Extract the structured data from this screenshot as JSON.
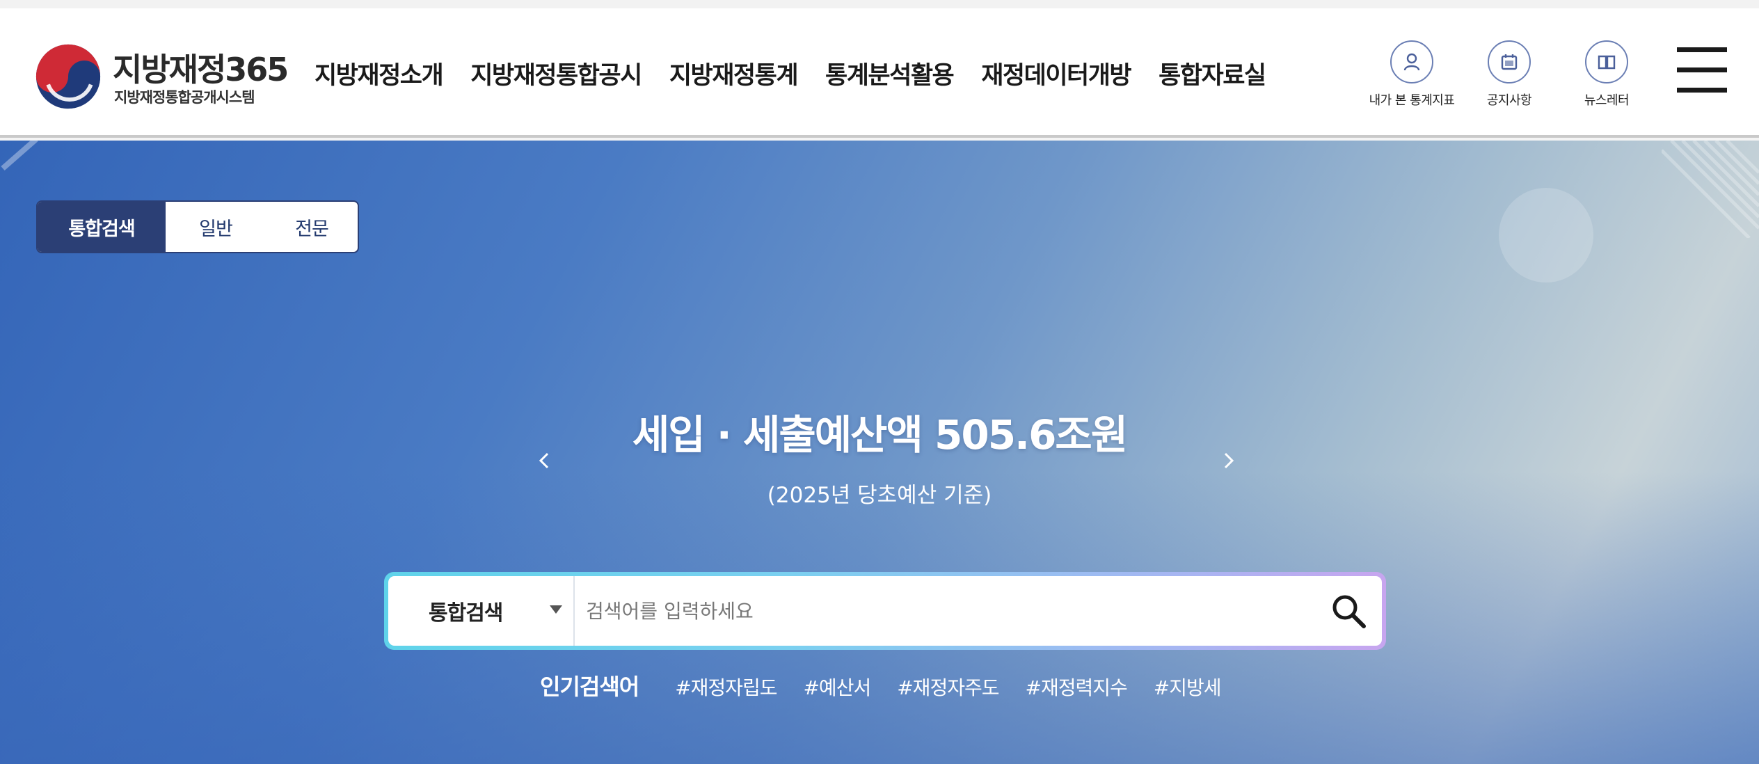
{
  "logo": {
    "title": "지방재정365",
    "subtitle": "지방재정통합공개시스템"
  },
  "nav": {
    "items": [
      "지방재정소개",
      "지방재정통합공시",
      "지방재정통계",
      "통계분석활용",
      "재정데이터개방",
      "통합자료실"
    ]
  },
  "utility": [
    {
      "label": "내가 본 통계지표",
      "icon": "user-icon"
    },
    {
      "label": "공지사항",
      "icon": "calendar-icon"
    },
    {
      "label": "뉴스레터",
      "icon": "book-icon"
    }
  ],
  "mode_tabs": {
    "items": [
      "통합검색",
      "일반",
      "전문"
    ],
    "active": "통합검색"
  },
  "banner": {
    "title": "세입 · 세출예산액 505.6조원",
    "subtitle": "(2025년 당초예산 기준)"
  },
  "search": {
    "scope_selected": "통합검색",
    "placeholder": "검색어를 입력하세요",
    "value": ""
  },
  "popular": {
    "title": "인기검색어",
    "keywords": [
      "#재정자립도",
      "#예산서",
      "#재정자주도",
      "#재정력지수",
      "#지방세"
    ]
  },
  "colors": {
    "header_bg": "#ffffff",
    "navy": "#2b3f75",
    "hero_blue": "#3465b8",
    "search_border": "#5fd3ea"
  }
}
